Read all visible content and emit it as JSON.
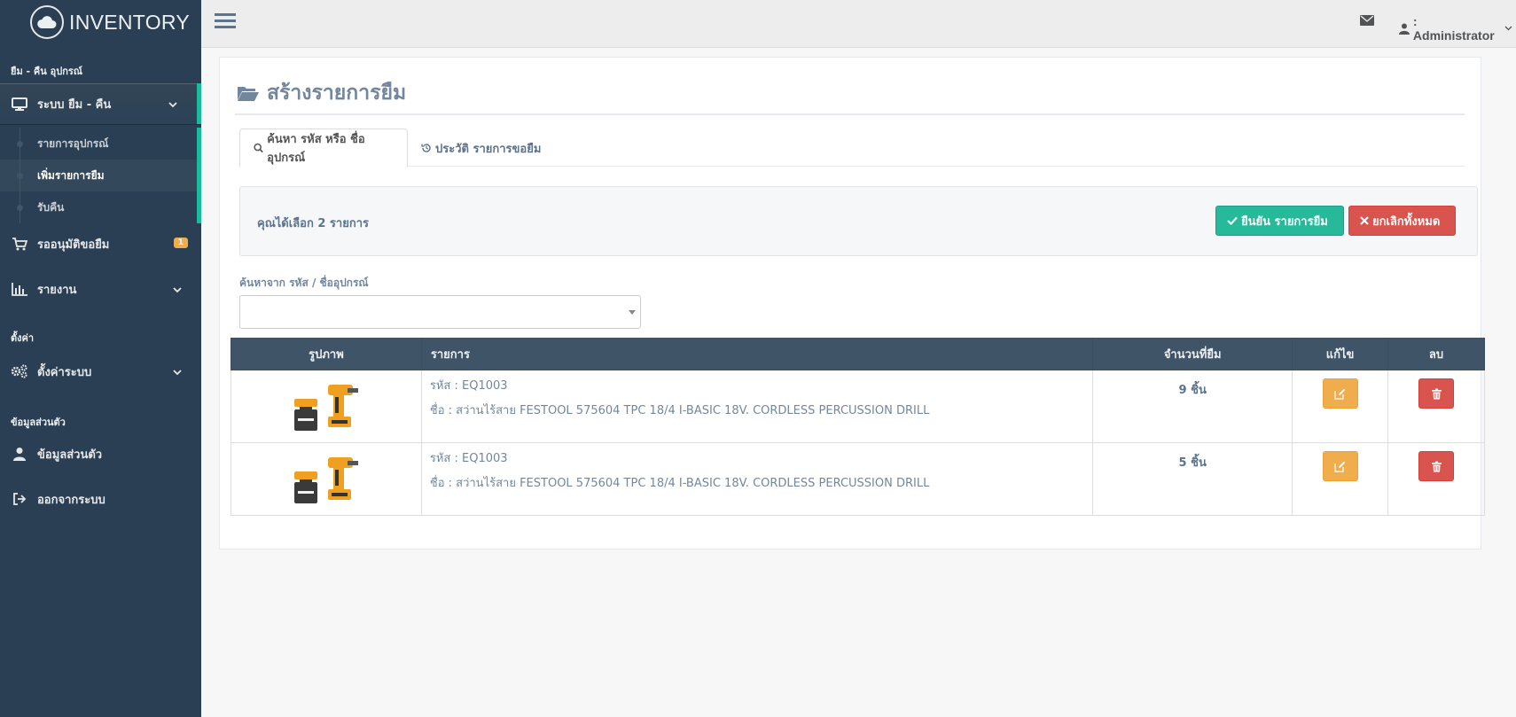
{
  "app": {
    "brand": "INVENTORY"
  },
  "sidebar": {
    "section_borrow": "ยืม - คืน อุปกรณ์",
    "menu_borrow_system": "ระบบ ยืม - คืน",
    "sub_items": [
      "รายการอุปกรณ์",
      "เพิ่มรายการยืม",
      "รับคืน"
    ],
    "menu_pending": "รออนุมัติขอยืม",
    "pending_count": "1",
    "menu_reports": "รายงาน",
    "section_settings": "ตั้งค่า",
    "menu_system_settings": "ตั้งค่าระบบ",
    "section_profile": "ข้อมูลส่วนตัว",
    "menu_profile": "ข้อมูลส่วนตัว",
    "menu_logout": "ออกจากระบบ"
  },
  "topbar": {
    "user_label": ": Administrator"
  },
  "page": {
    "title": "สร้างรายการยืม",
    "tabs": [
      "ค้นหา รหัส หรือ ชื่ออุปกรณ์",
      "ประวัติ รายการขอยืม"
    ],
    "selection_text": "คุณได้เลือก 2 รายการ",
    "confirm_label": "ยืนยัน รายการยืม",
    "cancel_all_label": "ยกเลิกทั้งหมด",
    "search_label": "ค้นหาจาก รหัส / ชื่ออุปกรณ์",
    "search_value": ""
  },
  "table": {
    "headers": [
      "รูปภาพ",
      "รายการ",
      "จำนวนที่ยืม",
      "แก้ไข",
      "ลบ"
    ],
    "rows": [
      {
        "code": "รหัส : EQ1003",
        "name": "ชื่อ : สว่านไร้สาย FESTOOL 575604 TPC 18/4 I-BASIC 18V. CORDLESS PERCUSSION DRILL",
        "qty": "9 ชิ้น"
      },
      {
        "code": "รหัส : EQ1003",
        "name": "ชื่อ : สว่านไร้สาย FESTOOL 575604 TPC 18/4 I-BASIC 18V. CORDLESS PERCUSSION DRILL",
        "qty": "5 ชิ้น"
      }
    ]
  },
  "colors": {
    "sidebar": "#2a3f54",
    "accent": "#1abb9c",
    "success": "#26b99a",
    "danger": "#d9534f",
    "warning": "#f0ad4e",
    "table_header": "#405467"
  }
}
